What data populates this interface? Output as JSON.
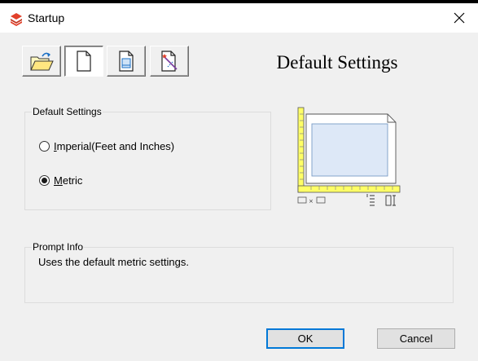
{
  "window": {
    "title": "Startup",
    "close_icon": "close-icon",
    "app_icon": "app-logo-icon"
  },
  "toolbar": {
    "buttons": [
      {
        "name": "open-drawing",
        "icon": "open-folder-icon",
        "active": false
      },
      {
        "name": "start-from-scratch",
        "icon": "blank-document-icon",
        "active": true
      },
      {
        "name": "use-template",
        "icon": "template-icon",
        "active": false
      },
      {
        "name": "use-wizard",
        "icon": "wizard-icon",
        "active": false
      }
    ]
  },
  "heading": "Default Settings",
  "settings_group": {
    "label": "Default Settings",
    "options": [
      {
        "label_first": "I",
        "label_rest": "mperial(Feet and Inches)",
        "checked": false
      },
      {
        "label_first": "M",
        "label_rest": "etric",
        "checked": true
      }
    ]
  },
  "prompt_group": {
    "label": "Prompt Info",
    "text": "Uses the default metric settings."
  },
  "buttons": {
    "ok": "OK",
    "cancel": "Cancel"
  },
  "colors": {
    "accent": "#0078d7",
    "ruler_yellow": "#ffff66",
    "sheet_blue": "#dde8f7",
    "logo_red": "#e2402a"
  }
}
